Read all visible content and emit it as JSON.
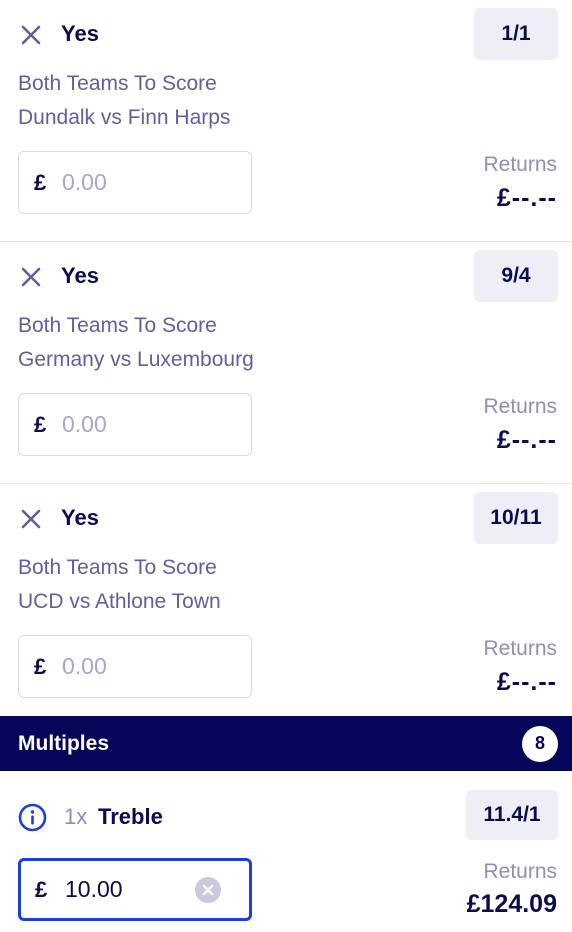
{
  "selections": [
    {
      "name": "Yes",
      "odds": "1/1",
      "market": "Both Teams To Score",
      "event": "Dundalk vs Finn Harps",
      "currency": "£",
      "stake_placeholder": "0.00",
      "returns_label": "Returns",
      "returns_value": "£--.--"
    },
    {
      "name": "Yes",
      "odds": "9/4",
      "market": "Both Teams To Score",
      "event": "Germany vs Luxembourg",
      "currency": "£",
      "stake_placeholder": "0.00",
      "returns_label": "Returns",
      "returns_value": "£--.--"
    },
    {
      "name": "Yes",
      "odds": "10/11",
      "market": "Both Teams To Score",
      "event": "UCD vs Athlone Town",
      "currency": "£",
      "stake_placeholder": "0.00",
      "returns_label": "Returns",
      "returns_value": "£--.--"
    }
  ],
  "multiples": {
    "title": "Multiples",
    "count": "8",
    "bet": {
      "count_label": "1x",
      "name": "Treble",
      "odds": "11.4/1",
      "currency": "£",
      "stake_value": "10.00",
      "returns_label": "Returns",
      "returns_value": "£124.09"
    }
  },
  "colors": {
    "navy": "#05055a",
    "text": "#0b0b4d",
    "muted": "#5f5f9c",
    "focus": "#1f3ddb"
  }
}
